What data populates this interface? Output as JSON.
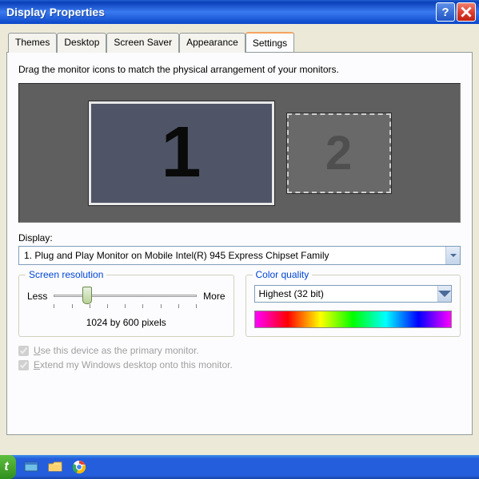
{
  "title": "Display Properties",
  "tabs": [
    "Themes",
    "Desktop",
    "Screen Saver",
    "Appearance",
    "Settings"
  ],
  "active_tab": "Settings",
  "instruction": "Drag the monitor icons to match the physical arrangement of your monitors.",
  "monitors": {
    "primary": "1",
    "secondary": "2"
  },
  "display_label": "Display:",
  "display_value": "1. Plug and Play Monitor on Mobile Intel(R) 945 Express Chipset Family",
  "resolution": {
    "legend": "Screen resolution",
    "less": "Less",
    "more": "More",
    "value": "1024 by 600 pixels"
  },
  "color_quality": {
    "legend": "Color quality",
    "value": "Highest (32 bit)"
  },
  "checks": {
    "primary": {
      "u": "U",
      "rest": "se this device as the primary monitor."
    },
    "extend": {
      "u": "E",
      "rest": "xtend my Windows desktop onto this monitor."
    }
  },
  "start_text": "t"
}
